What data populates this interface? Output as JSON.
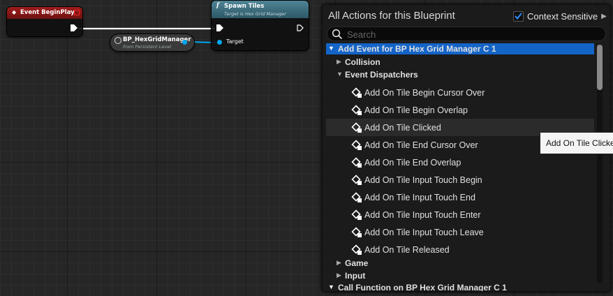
{
  "graph": {
    "event_node": {
      "title": "Event BeginPlay"
    },
    "ref_node": {
      "title": "BP_HexGridManager",
      "subtitle": "from Persistent Level"
    },
    "func_node": {
      "title": "Spawn Tiles",
      "subtitle": "Target is Hex Grid Manager",
      "target_pin": "Target"
    }
  },
  "panel": {
    "title": "All Actions for this Blueprint",
    "context_sensitive": {
      "label": "Context Sensitive",
      "checked": true
    },
    "search": {
      "placeholder": "Search",
      "value": ""
    },
    "tree": [
      {
        "label": "Add Event for BP Hex Grid Manager C 1",
        "kind": "root",
        "expanded": true,
        "selected": true
      },
      {
        "label": "Collision",
        "kind": "category",
        "expanded": false
      },
      {
        "label": "Event Dispatchers",
        "kind": "category",
        "expanded": true
      },
      {
        "label": "Add On Tile Begin Cursor Over",
        "kind": "action"
      },
      {
        "label": "Add On Tile Begin Overlap",
        "kind": "action"
      },
      {
        "label": "Add On Tile Clicked",
        "kind": "action",
        "hovered": true
      },
      {
        "label": "Add On Tile End Cursor Over",
        "kind": "action"
      },
      {
        "label": "Add On Tile End Overlap",
        "kind": "action"
      },
      {
        "label": "Add On Tile Input Touch Begin",
        "kind": "action"
      },
      {
        "label": "Add On Tile Input Touch End",
        "kind": "action"
      },
      {
        "label": "Add On Tile Input Touch Enter",
        "kind": "action"
      },
      {
        "label": "Add On Tile Input Touch Leave",
        "kind": "action"
      },
      {
        "label": "Add On Tile Released",
        "kind": "action"
      },
      {
        "label": "Game",
        "kind": "category",
        "expanded": false
      },
      {
        "label": "Input",
        "kind": "category",
        "expanded": false
      },
      {
        "label": "Call Function on BP Hex Grid Manager C 1",
        "kind": "root",
        "expanded": true
      }
    ],
    "tooltip": "Add On Tile Clicked"
  },
  "colors": {
    "event_header": "#8b1818",
    "function_header": "#3e6b7b",
    "selection": "#1464c8",
    "object_pin": "#00a8f0"
  }
}
